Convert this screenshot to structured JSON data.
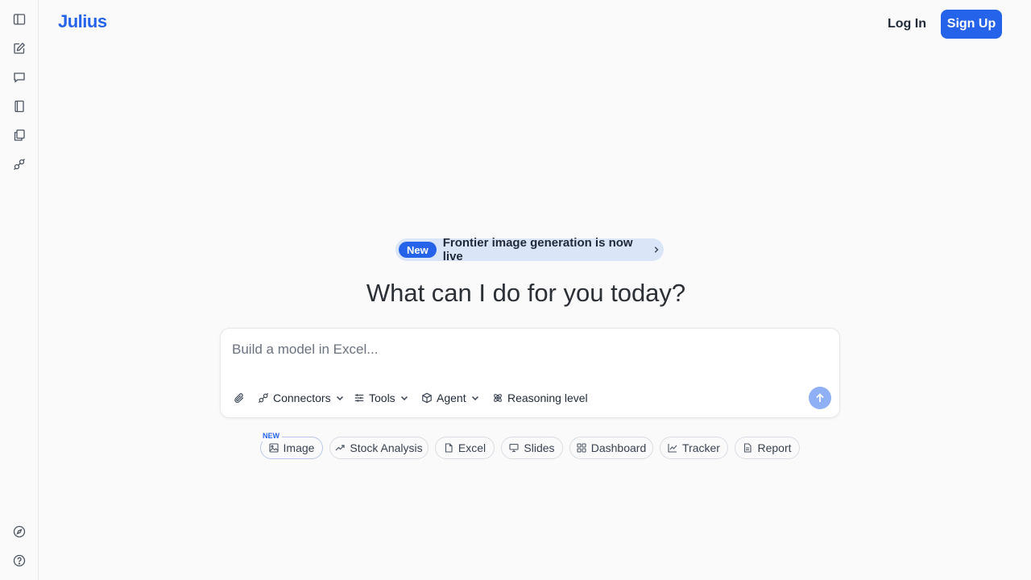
{
  "brand": {
    "logo": "Julius"
  },
  "auth": {
    "login": "Log In",
    "signup": "Sign Up"
  },
  "announcement": {
    "badge": "New",
    "text": "Frontier image generation is now live"
  },
  "headline": "What can I do for you today?",
  "composer": {
    "placeholder": "Build a model in Excel...",
    "tools": {
      "connectors": "Connectors",
      "tools": "Tools",
      "agent": "Agent",
      "reasoning": "Reasoning level"
    }
  },
  "suggestions": {
    "new_tag": "NEW",
    "items": [
      "Image",
      "Stock Analysis",
      "Excel",
      "Slides",
      "Dashboard",
      "Tracker",
      "Report"
    ]
  },
  "sidebar": {
    "icons": [
      "sidebar-toggle-icon",
      "new-chat-icon",
      "chats-icon",
      "notebook-icon",
      "files-icon",
      "connectors-icon",
      "explore-icon",
      "help-icon"
    ]
  },
  "colors": {
    "accent": "#2563eb",
    "background": "#fafafa",
    "send_disabled": "#8fb0f4"
  }
}
